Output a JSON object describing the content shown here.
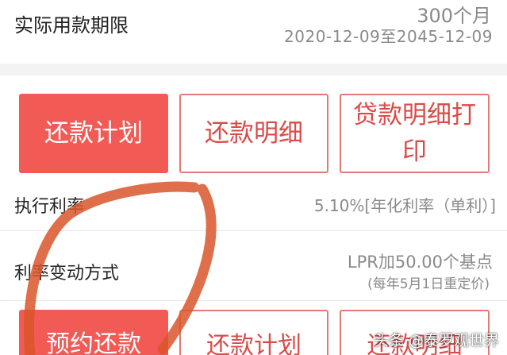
{
  "loan_term": {
    "label": "实际用款期限",
    "months": "300个月",
    "range": "2020-12-09至2045-12-09"
  },
  "actions_top": {
    "plan": "还款计划",
    "details": "还款明细",
    "print_line1": "贷款明细打",
    "print_line2": "印"
  },
  "rate": {
    "label": "执行利率",
    "value": "5.10%[年化利率（单利）]"
  },
  "rate_change": {
    "label": "利率变动方式",
    "value": "LPR加50.00个基点",
    "note": "(每年5月1日重定价)"
  },
  "actions_bottom": {
    "reserve": "预约还款",
    "plan": "还款计划",
    "details": "还款明细"
  },
  "watermark": "头条 @泰罗观世界",
  "colors": {
    "accent": "#f25a55",
    "annotation": "#d9562a"
  }
}
